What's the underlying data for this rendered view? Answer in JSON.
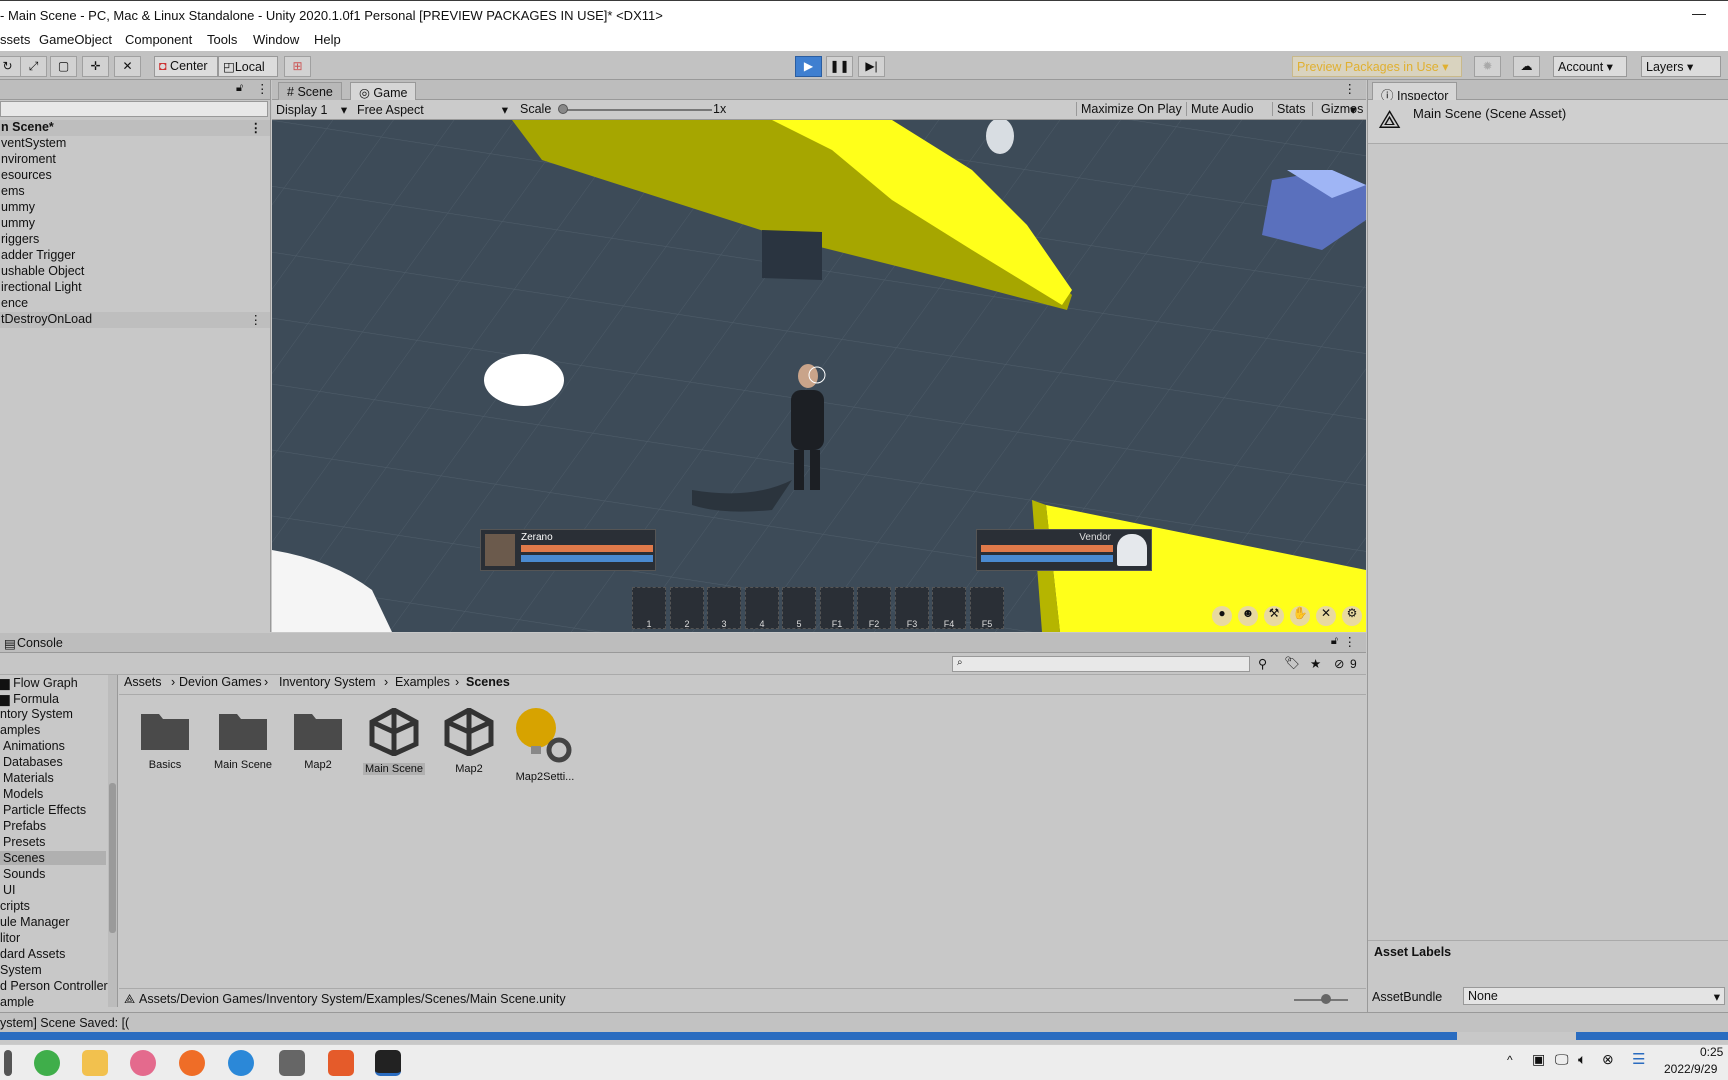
{
  "window": {
    "title": "- Main Scene - PC, Mac & Linux Standalone - Unity 2020.1.0f1 Personal [PREVIEW PACKAGES IN USE]* <DX11>",
    "minimize": "—"
  },
  "menu": [
    "ssets",
    "GameObject",
    "Component",
    "Tools",
    "Window",
    "Help"
  ],
  "toolbar": {
    "pivot": "Center",
    "space": "Local",
    "preview_packages": "Preview Packages in Use",
    "account": "Account",
    "layers": "Layers"
  },
  "hierarchy": {
    "scene": "n Scene*",
    "items": [
      "ventSystem",
      "nviroment",
      "esources",
      "ems",
      "ummy",
      "ummy",
      "riggers",
      "adder Trigger",
      "ushable Object",
      "irectional Light",
      "ence",
      "tDestroyOnLoad"
    ]
  },
  "tabs": {
    "scene": "Scene",
    "game": "Game"
  },
  "gamebar": {
    "display": "Display 1",
    "aspect": "Free Aspect",
    "scale_label": "Scale",
    "scale_value": "1x",
    "maximize": "Maximize On Play",
    "mute": "Mute Audio",
    "stats": "Stats",
    "gizmos": "Gizmos"
  },
  "game_hud": {
    "player_name": "Zerano",
    "vendor_name": "Vendor",
    "slots": [
      "1",
      "2",
      "3",
      "4",
      "5",
      "F1",
      "F2",
      "F3",
      "F4",
      "F5"
    ]
  },
  "inspector": {
    "tab": "Inspector",
    "title": "Main Scene (Scene Asset)",
    "asset_labels": "Asset Labels",
    "assetbundle_label": "AssetBundle",
    "assetbundle_value": "None"
  },
  "console": {
    "tab": "Console",
    "count": "9"
  },
  "project_tree": [
    "Flow Graph",
    "Formula",
    "ntory System",
    "amples",
    "Animations",
    "Databases",
    "Materials",
    "Models",
    "Particle Effects",
    "Prefabs",
    "Presets",
    "Scenes",
    "Sounds",
    "UI",
    "cripts",
    "ule Manager",
    "litor",
    "dard Assets",
    "System",
    "d Person Controller",
    "ample"
  ],
  "breadcrumb": [
    "Assets",
    "Devion Games",
    "Inventory System",
    "Examples",
    "Scenes"
  ],
  "assets": [
    {
      "label": "Basics",
      "icon": "folder-icon"
    },
    {
      "label": "Main Scene",
      "icon": "folder-icon"
    },
    {
      "label": "Map2",
      "icon": "folder-icon"
    },
    {
      "label": "Main Scene",
      "icon": "unity-scene-icon"
    },
    {
      "label": "Map2",
      "icon": "unity-scene-icon"
    },
    {
      "label": "Map2Setti...",
      "icon": "lighting-settings-icon"
    }
  ],
  "status_path": "Assets/Devion Games/Inventory System/Examples/Scenes/Main Scene.unity",
  "status_message": "ystem] Scene Saved: [(",
  "clock": {
    "time": "0:25",
    "date": "2022/9/29"
  },
  "colors": {
    "play_blue": "#3f7fd0",
    "preview_yellow": "#e0b030",
    "game_yellow": "#ffff1a"
  }
}
